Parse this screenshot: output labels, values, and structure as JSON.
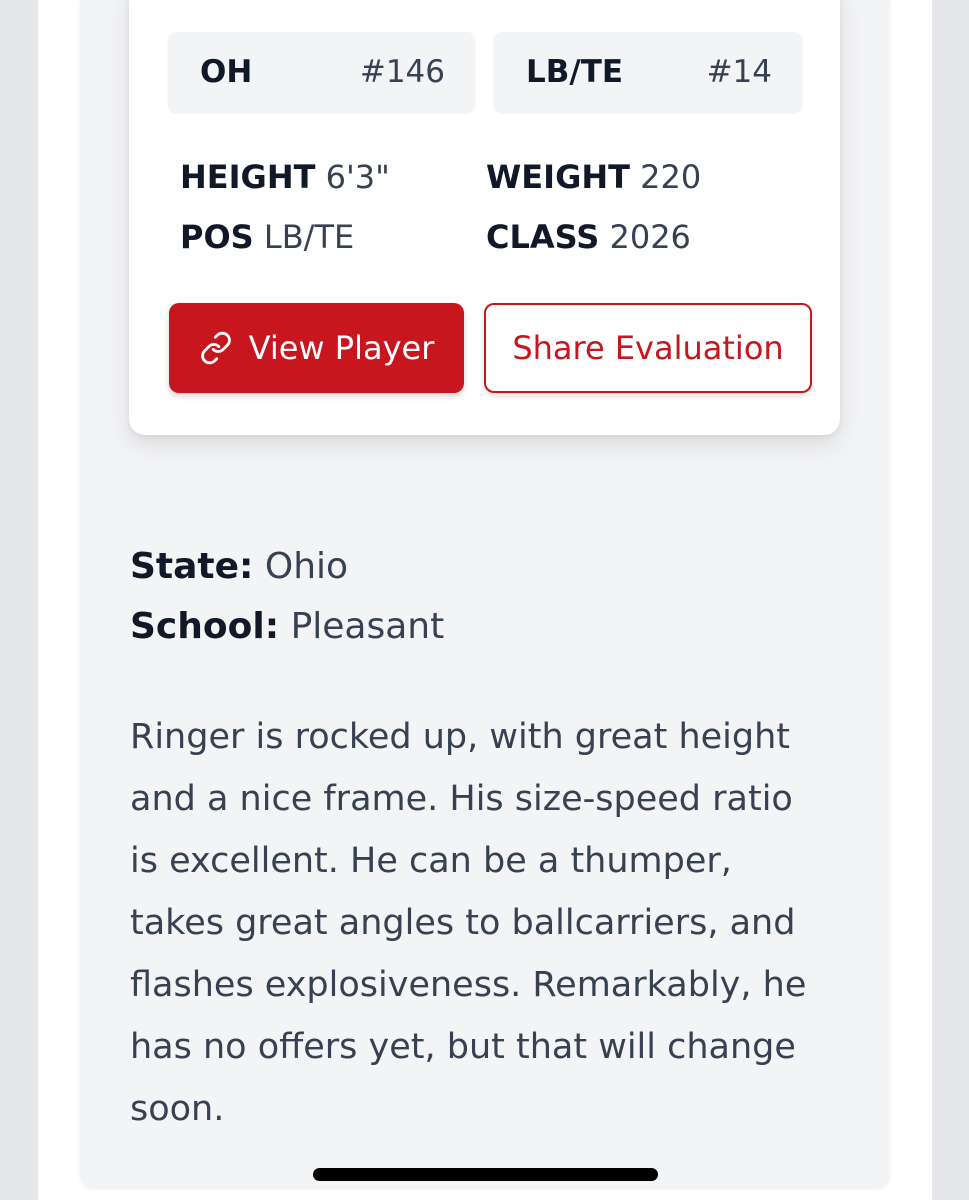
{
  "rankings": {
    "state": {
      "label": "OH",
      "value": "#146"
    },
    "position": {
      "label": "LB/TE",
      "value": "#14"
    }
  },
  "stats": {
    "height": {
      "label": "HEIGHT",
      "value": "6'3\""
    },
    "weight": {
      "label": "WEIGHT",
      "value": "220"
    },
    "pos": {
      "label": "POS",
      "value": "LB/TE"
    },
    "class": {
      "label": "CLASS",
      "value": "2026"
    }
  },
  "actions": {
    "view_player": "View Player",
    "share_evaluation": "Share Evaluation"
  },
  "info": {
    "state": {
      "label": "State:",
      "value": "Ohio"
    },
    "school": {
      "label": "School:",
      "value": "Pleasant"
    }
  },
  "evaluation": "Ringer is rocked up, with great height and a nice frame. His size-speed ratio is excellent. He can be a thumper, takes great angles to ballcarriers, and flashes explosiveness. Remarkably, he has no offers yet, but that will change soon.",
  "colors": {
    "accent": "#c8161e",
    "text_dark": "#111827",
    "text_muted": "#374151",
    "panel_bg": "#f3f4f6"
  },
  "icons": {
    "view_player": "link-icon"
  }
}
